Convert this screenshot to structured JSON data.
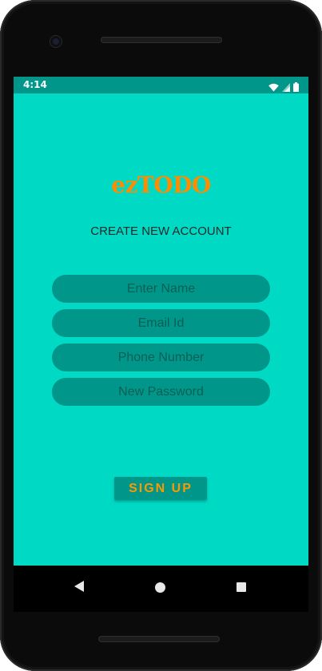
{
  "status_bar": {
    "time": "4:14"
  },
  "app": {
    "logo_text": "ezTODO",
    "subtitle": "CREATE NEW ACCOUNT",
    "fields": {
      "name_placeholder": "Enter Name",
      "email_placeholder": "Email Id",
      "phone_placeholder": "Phone Number",
      "password_placeholder": "New Password"
    },
    "signup_label": "SIGN UP"
  },
  "colors": {
    "background": "#00d9c4",
    "status_bar": "#00978a",
    "field_bg": "#00978a",
    "logo": "#ff8c00",
    "button_text": "#ff9800"
  },
  "icons": {
    "status": [
      "wifi-icon",
      "cell-signal-icon",
      "battery-icon"
    ],
    "navigation": [
      "back-icon",
      "home-icon",
      "recents-icon"
    ]
  }
}
